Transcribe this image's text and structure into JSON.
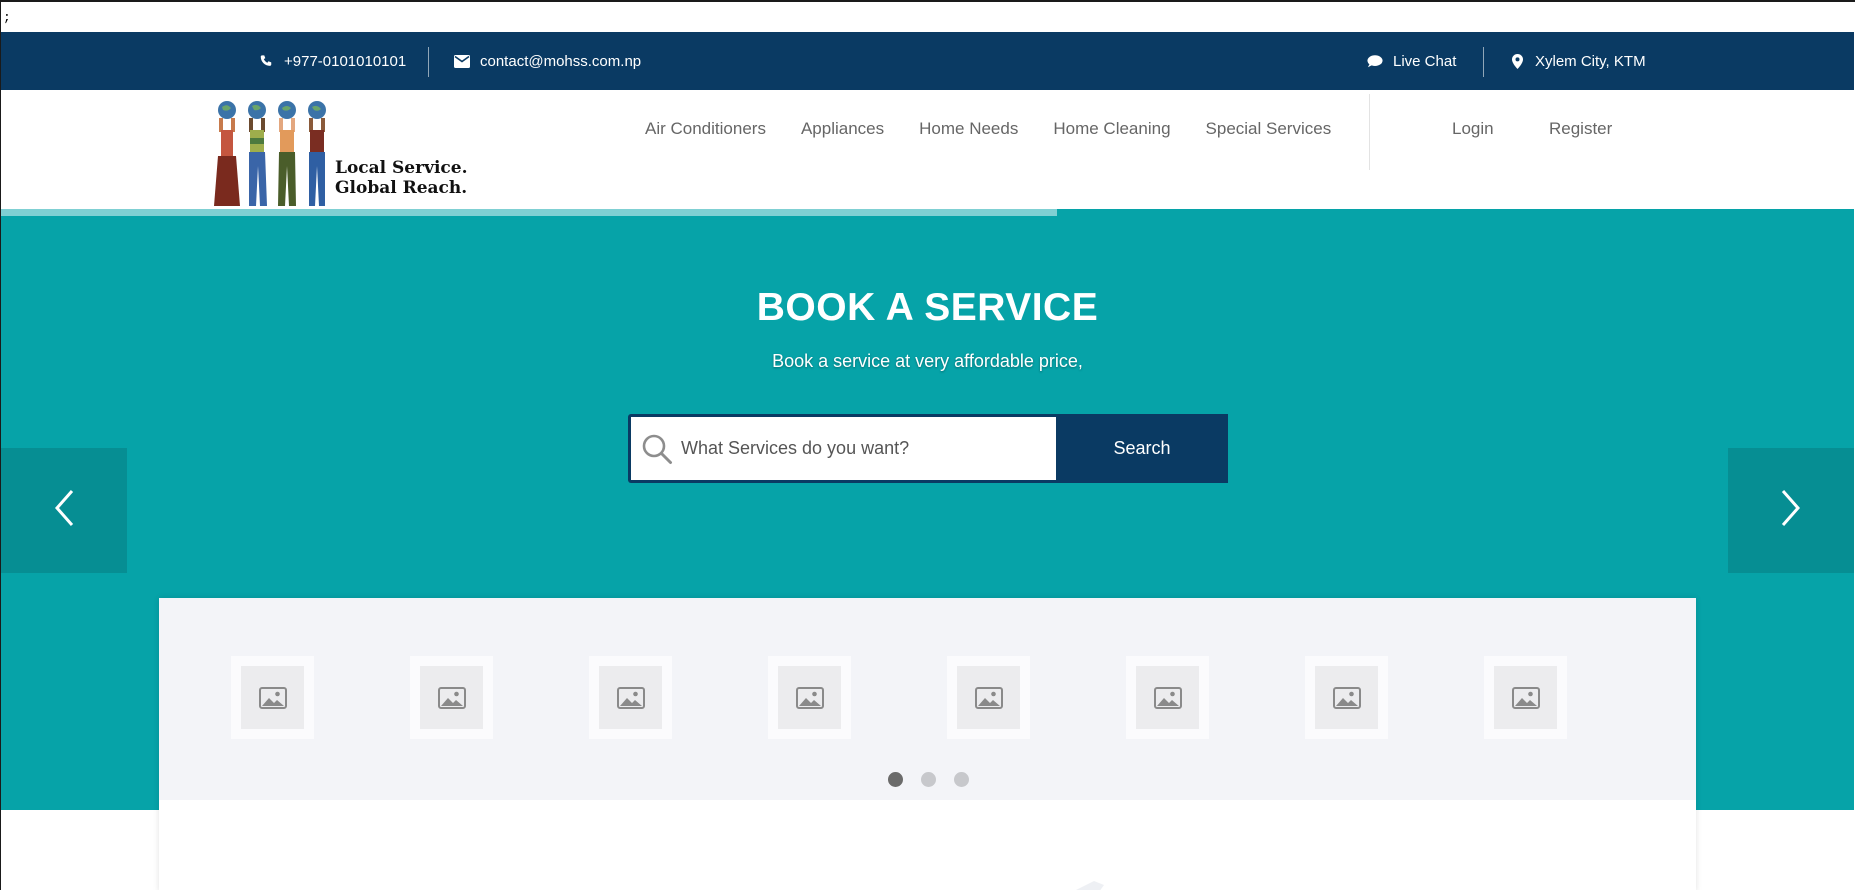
{
  "stray_text": ";",
  "topbar": {
    "phone": "+977-0101010101",
    "email": "contact@mohss.com.np",
    "live_chat": "Live Chat",
    "location": "Xylem City, KTM",
    "icons": [
      "phone-icon",
      "envelope-icon",
      "chat-bubble-icon",
      "map-pin-icon"
    ]
  },
  "header": {
    "logo_text": [
      "Local Service.",
      "Global Reach."
    ],
    "nav": [
      "Air Conditioners",
      "Appliances",
      "Home Needs",
      "Home Cleaning",
      "Special Services"
    ],
    "login": "Login",
    "register": "Register",
    "progress": 0.57
  },
  "hero": {
    "title": "BOOK A SERVICE",
    "subtitle": "Book a service at very affordable price,",
    "search_placeholder": "What Services do you want?",
    "search_button": "Search",
    "prev_icon": "chevron-left-icon",
    "next_icon": "chevron-right-icon"
  },
  "carousel": {
    "thumb_count": 8,
    "thumb_icon": "image-placeholder-icon",
    "dots": 3,
    "active_dot": 1
  },
  "colors": {
    "topbar": "#0a3a63",
    "hero": "#06a3a8",
    "arrow_bg": "#068e93",
    "panel": "#f3f4f8"
  }
}
